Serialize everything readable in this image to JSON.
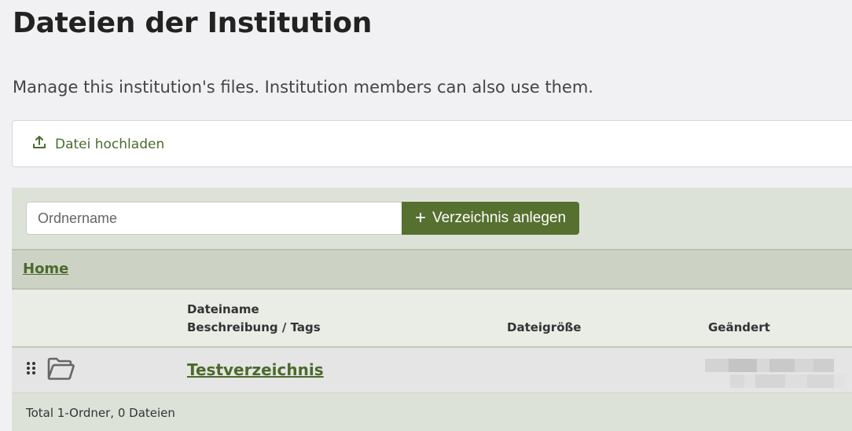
{
  "page": {
    "title": "Dateien der Institution",
    "description": "Manage this institution's files. Institution members can also use them."
  },
  "upload": {
    "label": "Datei hochladen",
    "icon": "upload-icon"
  },
  "folder_form": {
    "placeholder": "Ordnername",
    "value": "",
    "create_label": "Verzeichnis anlegen",
    "create_icon": "plus-icon"
  },
  "breadcrumb": {
    "home": "Home"
  },
  "table": {
    "headers": {
      "name": "Dateiname",
      "desc": "Beschreibung / Tags",
      "size": "Dateigröße",
      "date": "Geändert"
    },
    "rows": [
      {
        "name": "Testverzeichnis",
        "type": "folder",
        "icon": "folder-open-icon",
        "size": "",
        "date": ""
      }
    ]
  },
  "footer": {
    "summary": "Total 1-Ordner, 0 Dateien"
  },
  "colors": {
    "accent": "#55702f",
    "link": "#4b6a2c",
    "panel_bg": "#dde2d9",
    "crumb_bg": "#cdd3c4"
  }
}
